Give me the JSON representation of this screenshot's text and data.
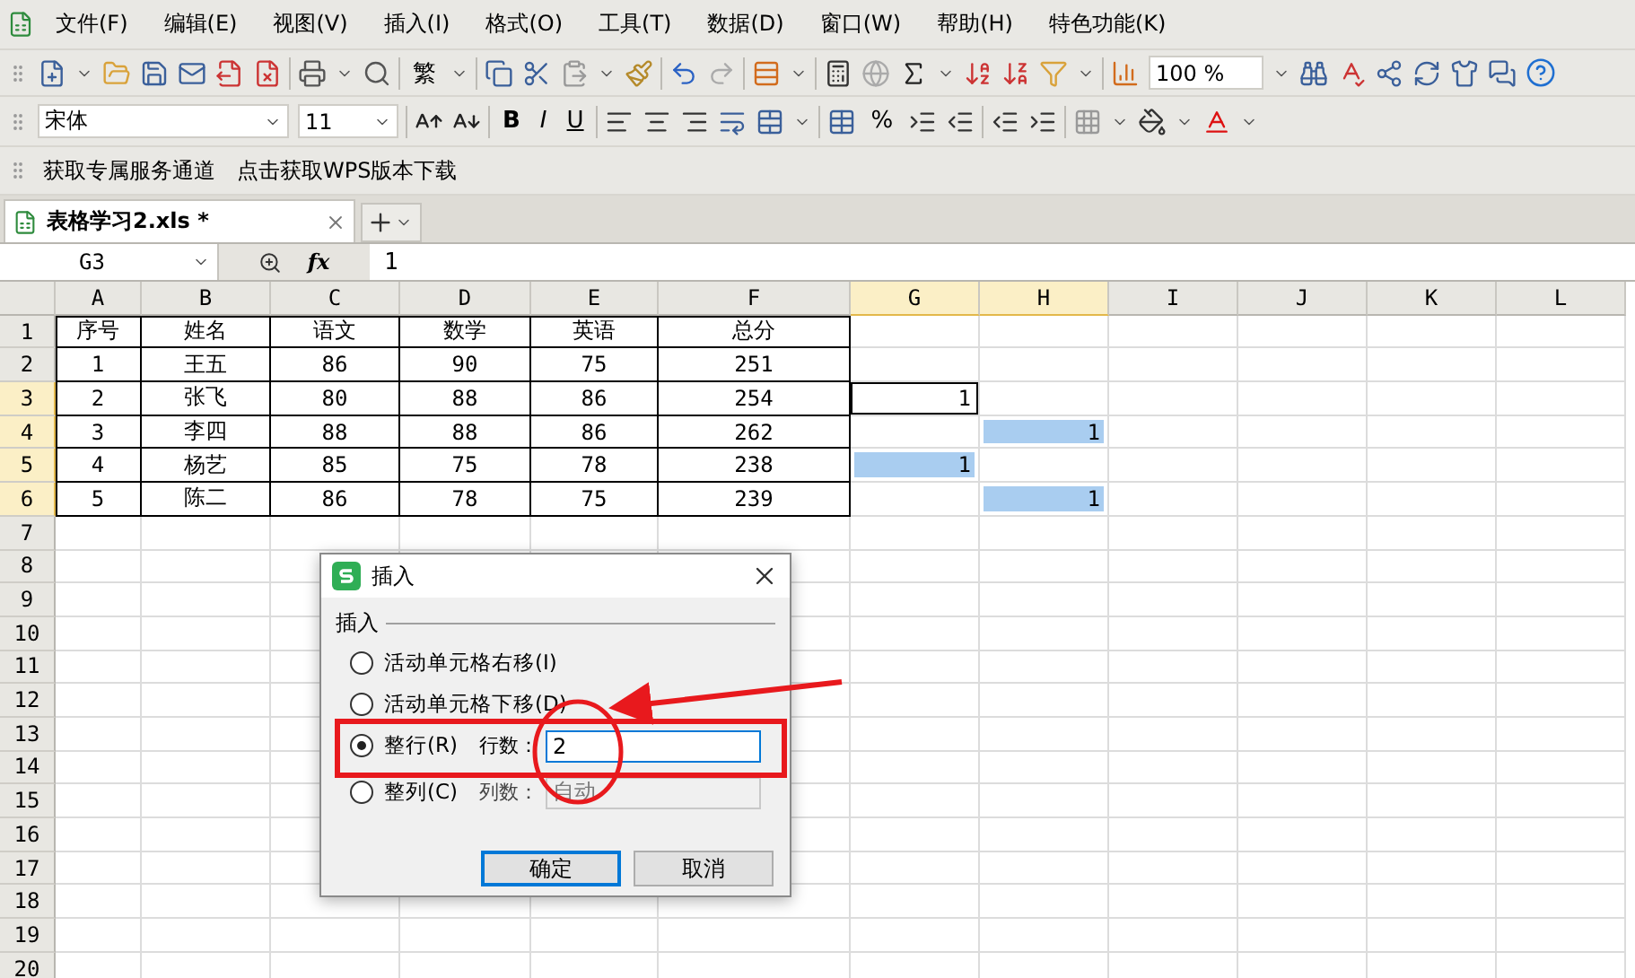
{
  "menu": {
    "items": [
      "文件(F)",
      "编辑(E)",
      "视图(V)",
      "插入(I)",
      "格式(O)",
      "工具(T)",
      "数据(D)",
      "窗口(W)",
      "帮助(H)",
      "特色功能(K)"
    ]
  },
  "standard_toolbar": {
    "traditional": "繁",
    "zoom": "100 %"
  },
  "format_toolbar": {
    "font": "宋体",
    "size": "11",
    "bold": "B",
    "italic": "I",
    "underline": "U",
    "percent": "%"
  },
  "quick_links": [
    "获取专属服务通道",
    "点击获取WPS版本下载"
  ],
  "tabs": [
    {
      "label": "表格学习2.xls *",
      "selected": true
    }
  ],
  "formula_bar": {
    "name_box": "G3",
    "fx": "fx",
    "value": "1"
  },
  "sheet": {
    "columns": [
      {
        "label": "A",
        "selected": false
      },
      {
        "label": "B",
        "selected": false
      },
      {
        "label": "C",
        "selected": false
      },
      {
        "label": "D",
        "selected": false
      },
      {
        "label": "E",
        "selected": false
      },
      {
        "label": "F",
        "selected": false
      },
      {
        "label": "G",
        "selected": true
      },
      {
        "label": "H",
        "selected": true
      },
      {
        "label": "I",
        "selected": false
      },
      {
        "label": "J",
        "selected": false
      },
      {
        "label": "K",
        "selected": false
      },
      {
        "label": "L",
        "selected": false
      }
    ],
    "rows": [
      {
        "label": "1",
        "selected": false,
        "cells": [
          "序号",
          "姓名",
          "语文",
          "数学",
          "英语",
          "总分"
        ]
      },
      {
        "label": "2",
        "selected": false,
        "cells": [
          "1",
          "王五",
          "86",
          "90",
          "75",
          "251"
        ]
      },
      {
        "label": "3",
        "selected": true,
        "cells": [
          "2",
          "张飞",
          "80",
          "88",
          "86",
          "254"
        ],
        "g": {
          "value": "1",
          "active": true,
          "selected": false
        }
      },
      {
        "label": "4",
        "selected": true,
        "cells": [
          "3",
          "李四",
          "88",
          "88",
          "86",
          "262"
        ],
        "h": {
          "value": "1",
          "active": false,
          "selected": true
        }
      },
      {
        "label": "5",
        "selected": true,
        "cells": [
          "4",
          "杨艺",
          "85",
          "75",
          "78",
          "238"
        ],
        "g": {
          "value": "1",
          "active": false,
          "selected": true
        }
      },
      {
        "label": "6",
        "selected": true,
        "cells": [
          "5",
          "陈二",
          "86",
          "78",
          "75",
          "239"
        ],
        "h": {
          "value": "1",
          "active": false,
          "selected": true
        }
      },
      {
        "label": "7",
        "selected": false
      },
      {
        "label": "8",
        "selected": false
      },
      {
        "label": "9",
        "selected": false
      },
      {
        "label": "10",
        "selected": false
      },
      {
        "label": "11",
        "selected": false
      },
      {
        "label": "12",
        "selected": false
      },
      {
        "label": "13",
        "selected": false
      },
      {
        "label": "14",
        "selected": false
      },
      {
        "label": "15",
        "selected": false
      },
      {
        "label": "16",
        "selected": false
      },
      {
        "label": "17",
        "selected": false
      },
      {
        "label": "18",
        "selected": false
      },
      {
        "label": "19",
        "selected": false
      },
      {
        "label": "20",
        "selected": false
      }
    ]
  },
  "dialog": {
    "title": "插入",
    "group": "插入",
    "options": [
      {
        "label": "活动单元格右移(I)",
        "selected": false
      },
      {
        "label": "活动单元格下移(D)",
        "selected": false
      },
      {
        "label": "整行(R)",
        "selected": true,
        "field_label": "行数：",
        "value": "2",
        "disabled": false
      },
      {
        "label": "整列(C)",
        "selected": false,
        "field_label": "列数：",
        "value": "自动",
        "disabled": true
      }
    ],
    "buttons": [
      "确定",
      "取消"
    ]
  }
}
